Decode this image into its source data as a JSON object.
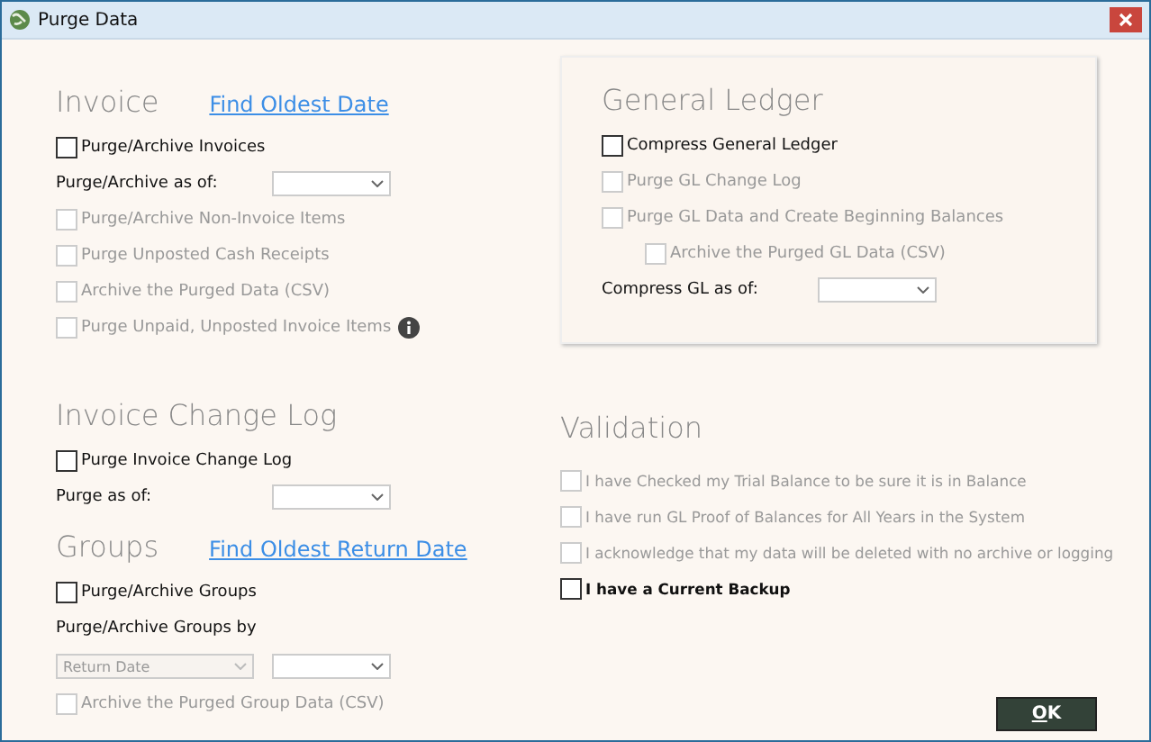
{
  "window": {
    "title": "Purge Data"
  },
  "invoice": {
    "heading": "Invoice",
    "link": "Find Oldest Date",
    "items": [
      {
        "kind": "checkbox",
        "label": "Purge/Archive Invoices",
        "checked": false,
        "disabled": false
      },
      {
        "kind": "date",
        "label": "Purge/Archive as of:"
      },
      {
        "kind": "checkbox",
        "label": "Purge/Archive Non-Invoice Items",
        "checked": false,
        "disabled": true
      },
      {
        "kind": "checkbox",
        "label": "Purge Unposted Cash Receipts",
        "checked": false,
        "disabled": true
      },
      {
        "kind": "checkbox",
        "label": "Archive the Purged Data (CSV)",
        "checked": false,
        "disabled": true
      },
      {
        "kind": "checkbox",
        "label": "Purge Unpaid, Unposted Invoice Items",
        "checked": false,
        "disabled": true,
        "info": true
      }
    ]
  },
  "general_ledger": {
    "heading": "General Ledger",
    "items": [
      {
        "kind": "checkbox",
        "label": "Compress General Ledger",
        "checked": false,
        "disabled": false
      },
      {
        "kind": "checkbox",
        "label": "Purge GL Change Log",
        "checked": false,
        "disabled": true
      },
      {
        "kind": "checkbox",
        "label": "Purge GL Data and Create Beginning Balances",
        "checked": false,
        "disabled": true,
        "children": [
          {
            "kind": "checkbox",
            "label": "Archive the Purged GL Data (CSV)",
            "checked": false,
            "disabled": true
          }
        ]
      },
      {
        "kind": "date",
        "label": "Compress GL as of:"
      }
    ]
  },
  "invoice_change_log": {
    "heading": "Invoice Change Log",
    "items": [
      {
        "kind": "checkbox",
        "label": "Purge Invoice Change Log",
        "checked": false,
        "disabled": false
      },
      {
        "kind": "date",
        "label": "Purge as of:"
      }
    ]
  },
  "groups": {
    "heading": "Groups",
    "link": "Find Oldest Return Date",
    "items": [
      {
        "kind": "checkbox",
        "label": "Purge/Archive Groups",
        "checked": false,
        "disabled": false
      },
      {
        "kind": "label",
        "label": "Purge/Archive Groups by"
      },
      {
        "kind": "dropdowns",
        "dropdowns": [
          {
            "value": "Return Date",
            "disabled": true
          },
          {
            "disabled": false
          }
        ]
      },
      {
        "kind": "checkbox",
        "label": "Archive the Purged Group Data (CSV)",
        "checked": false,
        "disabled": true
      }
    ]
  },
  "validation": {
    "heading": "Validation",
    "items": [
      {
        "kind": "checkbox",
        "label": "I have Checked my Trial Balance to be sure it is in Balance",
        "checked": false,
        "disabled": true
      },
      {
        "kind": "checkbox",
        "label": "I have run GL Proof of Balances for All Years in the System",
        "checked": false,
        "disabled": true
      },
      {
        "kind": "checkbox",
        "label": "I acknowledge that my data will be deleted with no archive or logging",
        "checked": false,
        "disabled": true
      },
      {
        "kind": "checkbox",
        "label": "I have a Current Backup",
        "checked": false,
        "disabled": false,
        "bold": true
      }
    ]
  },
  "buttons": [
    {
      "label": "OK"
    }
  ]
}
